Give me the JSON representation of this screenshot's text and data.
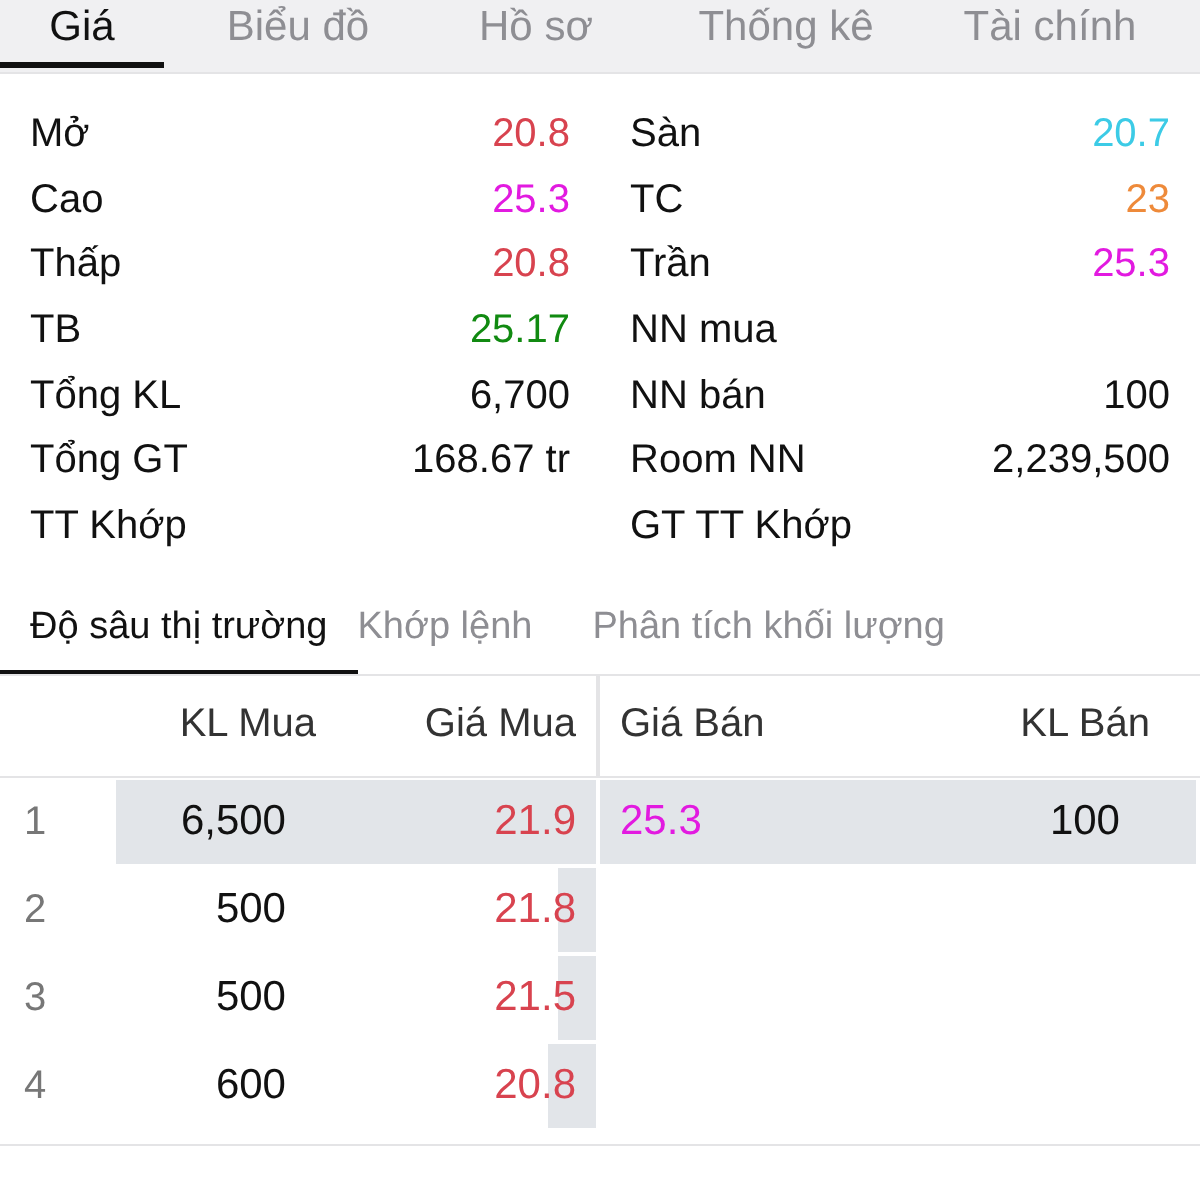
{
  "tabs": [
    {
      "label": "Giá",
      "selected": true
    },
    {
      "label": "Biểu đồ",
      "selected": false
    },
    {
      "label": "Hồ sơ",
      "selected": false
    },
    {
      "label": "Thống kê",
      "selected": false
    },
    {
      "label": "Tài chính",
      "selected": false
    }
  ],
  "stats_left": [
    {
      "label": "Mở",
      "value": "20.8",
      "color": "#d8434f"
    },
    {
      "label": "Cao",
      "value": "25.3",
      "color": "#e21ae0"
    },
    {
      "label": "Thấp",
      "value": "20.8",
      "color": "#d8434f"
    },
    {
      "label": "TB",
      "value": "25.17",
      "color": "#118a11"
    },
    {
      "label": "Tổng KL",
      "value": "6,700",
      "color": "#111111"
    },
    {
      "label": "Tổng GT",
      "value": "168.67 tr",
      "color": "#111111"
    },
    {
      "label": "TT Khớp"
    }
  ],
  "stats_right": [
    {
      "label": "Sàn",
      "value": "20.7",
      "color": "#3ccbe6"
    },
    {
      "label": "TC",
      "value": "23",
      "color": "#ee8a3a"
    },
    {
      "label": "Trần",
      "value": "25.3",
      "color": "#e21ae0"
    },
    {
      "label": "NN mua"
    },
    {
      "label": "NN bán",
      "value": "100",
      "color": "#111111"
    },
    {
      "label": "Room NN",
      "value": "2,239,500",
      "color": "#111111"
    },
    {
      "label": "GT TT Khớp"
    }
  ],
  "subtabs": [
    {
      "label": "Độ sâu thị trường",
      "selected": true
    },
    {
      "label": "Khớp lệnh",
      "selected": false
    },
    {
      "label": "Phân tích khối lượng",
      "selected": false
    }
  ],
  "depth": {
    "columns": [
      "KL Mua",
      "Giá Mua",
      "Giá Bán",
      "KL Bán"
    ],
    "rows": [
      {
        "index": "1",
        "bid": {
          "volume": "6,500",
          "price": "21.9",
          "level": 1.0
        },
        "ask": {
          "price": "25.3",
          "volume": "100",
          "level": 1.0
        }
      },
      {
        "index": "2",
        "bid": {
          "volume": "500",
          "price": "21.8",
          "level": 0.08
        }
      },
      {
        "index": "3",
        "bid": {
          "volume": "500",
          "price": "21.5",
          "level": 0.08
        }
      },
      {
        "index": "4",
        "bid": {
          "volume": "600",
          "price": "20.8",
          "level": 0.1
        }
      }
    ]
  }
}
